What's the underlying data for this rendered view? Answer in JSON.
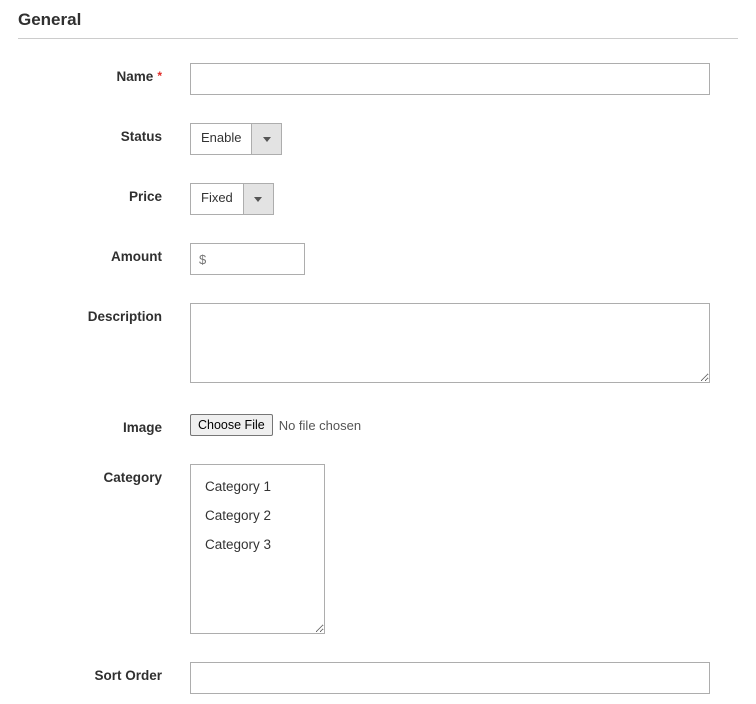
{
  "section_title": "General",
  "fields": {
    "name": {
      "label": "Name",
      "required_mark": "*",
      "value": ""
    },
    "status": {
      "label": "Status",
      "selected": "Enable"
    },
    "price": {
      "label": "Price",
      "selected": "Fixed"
    },
    "amount": {
      "label": "Amount",
      "placeholder": "$",
      "value": ""
    },
    "description": {
      "label": "Description",
      "value": ""
    },
    "image": {
      "label": "Image",
      "button_text": "Choose File",
      "status_text": "No file chosen"
    },
    "category": {
      "label": "Category",
      "options": [
        "Category 1",
        "Category 2",
        "Category 3"
      ]
    },
    "sort_order": {
      "label": "Sort Order",
      "value": ""
    }
  }
}
